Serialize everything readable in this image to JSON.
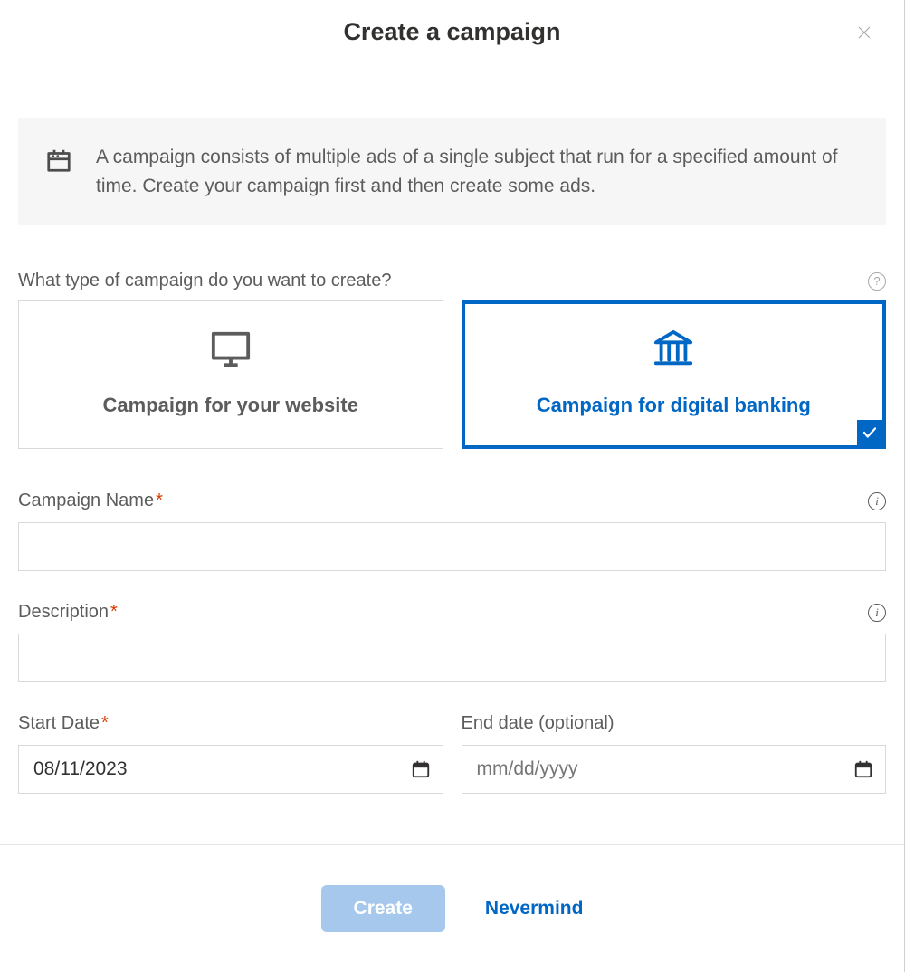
{
  "header": {
    "title": "Create a campaign"
  },
  "info": {
    "text": "A campaign consists of multiple ads of a single subject that run for a specified amount of time. Create your campaign first and then create some ads."
  },
  "type_section": {
    "question": "What type of campaign do you want to create?",
    "options": [
      {
        "label": "Campaign for your website",
        "icon": "monitor",
        "selected": false
      },
      {
        "label": "Campaign for digital banking",
        "icon": "bank",
        "selected": true
      }
    ]
  },
  "fields": {
    "name": {
      "label": "Campaign Name",
      "required": true,
      "value": ""
    },
    "description": {
      "label": "Description",
      "required": true,
      "value": ""
    },
    "start_date": {
      "label": "Start Date",
      "required": true,
      "value": "08/11/2023"
    },
    "end_date": {
      "label": "End date (optional)",
      "required": false,
      "placeholder": "mm/dd/yyyy",
      "value": ""
    }
  },
  "footer": {
    "primary": "Create",
    "cancel": "Nevermind"
  },
  "asterisk": "*"
}
